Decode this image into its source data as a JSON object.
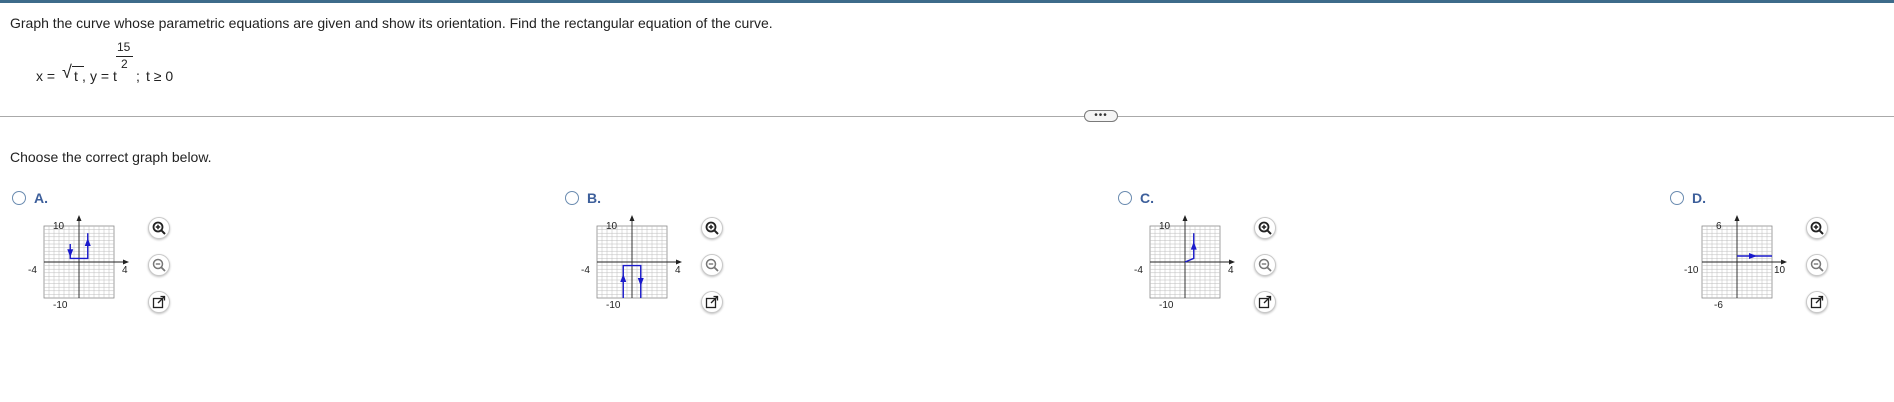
{
  "question": {
    "text": "Graph the curve whose parametric equations are given and show its orientation. Find the rectangular equation of the curve."
  },
  "equation": {
    "x_part": "x =",
    "sqrt_arg": "t",
    "comma": ",",
    "y_part": "y = t",
    "exp_num": "15",
    "exp_den": "2",
    "semicolon": ";",
    "condition": "t ≥ 0"
  },
  "more_button": {
    "label": "•••"
  },
  "prompt": {
    "text": "Choose the correct graph below."
  },
  "colors": {
    "accent": "#3d5f9b",
    "curve": "#1a1acc",
    "grid": "#bcbcbc"
  },
  "options": [
    {
      "letter": "A.",
      "x_min_label": "-4",
      "x_max_label": "4",
      "y_max_label": "10",
      "y_min_label": "-10",
      "x_range": [
        -4,
        4
      ],
      "y_range": [
        -10,
        10
      ],
      "curve": [
        [
          -1,
          5
        ],
        [
          -1,
          1
        ],
        [
          1,
          1
        ],
        [
          1,
          8
        ]
      ],
      "arrows": [
        {
          "at": [
            -1,
            3
          ],
          "dir": "down"
        },
        {
          "at": [
            1,
            5
          ],
          "dir": "up"
        }
      ]
    },
    {
      "letter": "B.",
      "x_min_label": "-4",
      "x_max_label": "4",
      "y_max_label": "10",
      "y_min_label": "-10",
      "x_range": [
        -4,
        4
      ],
      "y_range": [
        -10,
        10
      ],
      "curve": [
        [
          -1,
          -10
        ],
        [
          -1,
          -1
        ],
        [
          1,
          -1
        ],
        [
          1,
          -10
        ]
      ],
      "arrows": [
        {
          "at": [
            -1,
            -5
          ],
          "dir": "up"
        },
        {
          "at": [
            1,
            -5
          ],
          "dir": "down"
        }
      ]
    },
    {
      "letter": "C.",
      "x_min_label": "-4",
      "x_max_label": "4",
      "y_max_label": "10",
      "y_min_label": "-10",
      "x_range": [
        -4,
        4
      ],
      "y_range": [
        -10,
        10
      ],
      "curve": [
        [
          0,
          0
        ],
        [
          1,
          1
        ],
        [
          1,
          8
        ]
      ],
      "arrows": [
        {
          "at": [
            1,
            4
          ],
          "dir": "up"
        }
      ]
    },
    {
      "letter": "D.",
      "x_min_label": "-10",
      "x_max_label": "10",
      "y_max_label": "6",
      "y_min_label": "-6",
      "x_range": [
        -10,
        10
      ],
      "y_range": [
        -6,
        6
      ],
      "curve": [
        [
          0,
          1
        ],
        [
          10,
          1
        ]
      ],
      "arrows": [
        {
          "at": [
            4,
            1
          ],
          "dir": "right"
        }
      ]
    }
  ],
  "tools": {
    "zoom_in": "zoom-in-icon",
    "zoom_out": "zoom-out-icon",
    "expand": "expand-icon"
  }
}
